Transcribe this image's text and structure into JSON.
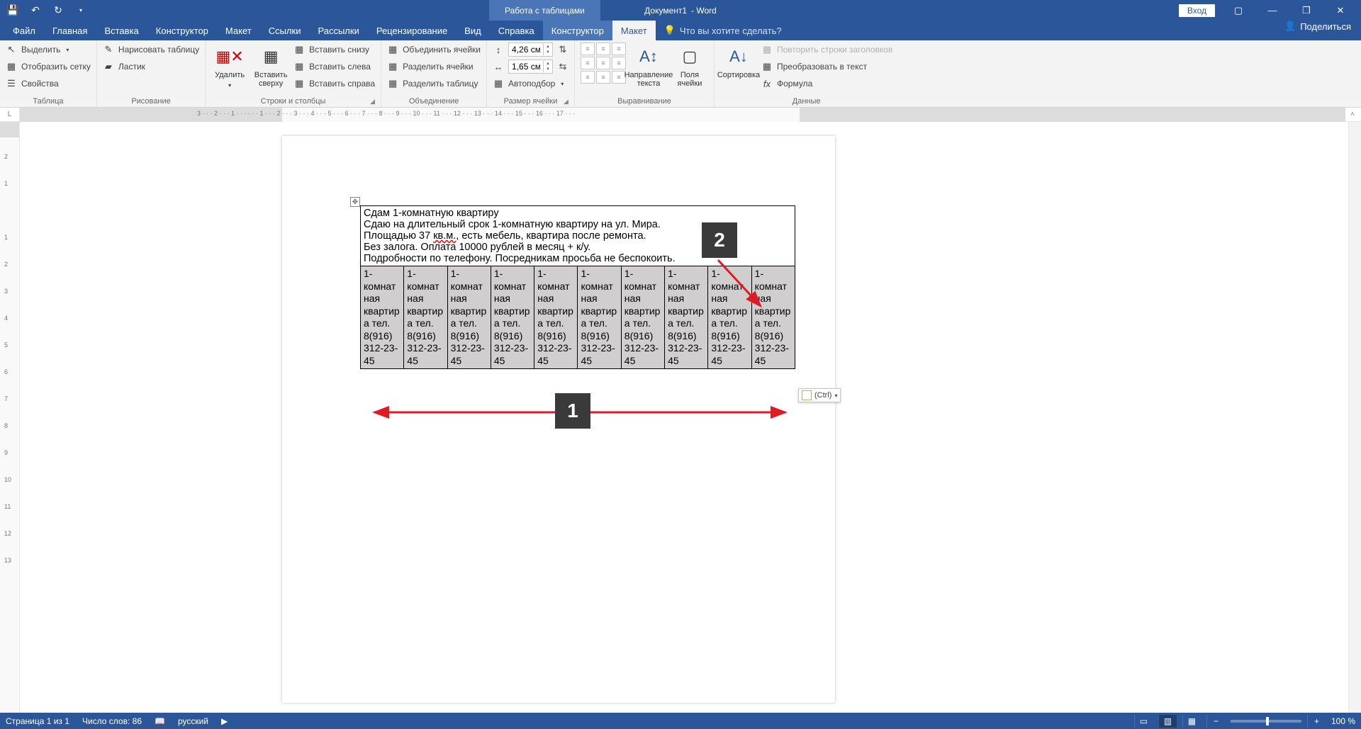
{
  "titlebar": {
    "document_title": "Документ1",
    "app_suffix": "-  Word",
    "contextual_title": "Работа с таблицами",
    "login": "Вход"
  },
  "tabs": {
    "file": "Файл",
    "home": "Главная",
    "insert": "Вставка",
    "design": "Конструктор",
    "layout": "Макет",
    "references": "Ссылки",
    "mailings": "Рассылки",
    "review": "Рецензирование",
    "view": "Вид",
    "help": "Справка",
    "table_design": "Конструктор",
    "table_layout": "Макет",
    "tell": "Что вы хотите сделать?",
    "share": "Поделиться"
  },
  "ribbon": {
    "table": {
      "label": "Таблица",
      "select": "Выделить",
      "gridlines": "Отобразить сетку",
      "properties": "Свойства"
    },
    "draw": {
      "label": "Рисование",
      "draw_table": "Нарисовать таблицу",
      "eraser": "Ластик"
    },
    "rowscols": {
      "label": "Строки и столбцы",
      "delete": "Удалить",
      "insert_above": "Вставить сверху",
      "insert_below": "Вставить снизу",
      "insert_left": "Вставить слева",
      "insert_right": "Вставить справа"
    },
    "merge": {
      "label": "Объединение",
      "merge_cells": "Объединить ячейки",
      "split_cells": "Разделить ячейки",
      "split_table": "Разделить таблицу"
    },
    "cellsize": {
      "label": "Размер ячейки",
      "height": "4,26 см",
      "width": "1,65 см",
      "autofit": "Автоподбор"
    },
    "alignment": {
      "label": "Выравнивание",
      "text_direction": "Направление текста",
      "cell_margins": "Поля ячейки"
    },
    "data": {
      "label": "Данные",
      "sort": "Сортировка",
      "repeat_header": "Повторить строки заголовков",
      "convert": "Преобразовать в текст",
      "formula": "Формула"
    }
  },
  "ruler": {
    "h_numbers": "3 · · · 2 · · · 1 · · ·   · · · 1 · · · 2 · · · 3 · · · 4 · · · 5 · · · 6 · · · 7 · · · 8 · · · 9 · · · 10 · · · 11 · · · 12 · · · 13 · · · 14 · · · 15 · · · 16 · · · 17 · · ·",
    "corner": "L"
  },
  "document": {
    "header_lines": [
      "Сдам 1-комнатную квартиру",
      "Сдаю на длительный срок 1-комнатную квартиру на ул. Мира.",
      "Площадью 37 ",
      ", есть мебель, квартира после ремонта.",
      "Без залога. Оплата 10000 рублей в месяц + к/у.",
      "Подробности по телефону. Посредникам просьба не беспокоить."
    ],
    "spell_fragment": "кв.м.",
    "cell_text": "1-комнатная квартира тел. 8(916) 312-23-45"
  },
  "paste_options": {
    "label": "(Ctrl)"
  },
  "annotations": {
    "one": "1",
    "two": "2"
  },
  "statusbar": {
    "page": "Страница 1 из 1",
    "words": "Число слов: 86",
    "language": "русский",
    "zoom": "100 %"
  }
}
